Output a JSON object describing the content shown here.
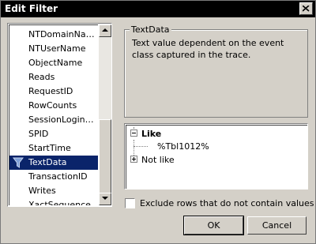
{
  "window": {
    "title": "Edit Filter"
  },
  "columns": {
    "items": [
      "NTDomainName",
      "NTUserName",
      "ObjectName",
      "Reads",
      "RequestID",
      "RowCounts",
      "SessionLoginNa...",
      "SPID",
      "StartTime",
      "TextData",
      "TransactionID",
      "Writes",
      "XactSequence"
    ],
    "selected": "TextData",
    "selected_icon": "filter-icon"
  },
  "description": {
    "legend": "TextData",
    "text": "Text value dependent on the event class captured in the trace."
  },
  "tree": {
    "like_label": "Like",
    "like_value": "%Tbl1012%",
    "not_like_label": "Not like"
  },
  "exclude_label": "Exclude rows that do not contain values",
  "exclude_checked": false,
  "buttons": {
    "ok": "OK",
    "cancel": "Cancel"
  },
  "colors": {
    "selection": "#0a246a",
    "titlebar": "#000000",
    "face": "#d4d0c8"
  }
}
